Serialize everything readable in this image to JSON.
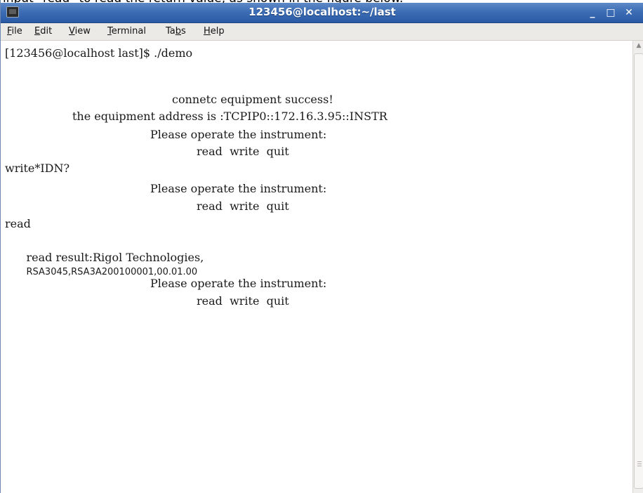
{
  "caption": "input \"read\" to read the return value, as shown in the figure below.",
  "window": {
    "title": "123456@localhost:~/last",
    "controls": {
      "minimize": "_",
      "maximize": "□",
      "close": "✕"
    }
  },
  "menu": [
    {
      "mnemonic": "F",
      "rest": "ile"
    },
    {
      "mnemonic": "E",
      "rest": "dit"
    },
    {
      "mnemonic": "V",
      "rest": "iew"
    },
    {
      "mnemonic": "T",
      "rest": "erminal"
    },
    {
      "pre": "Ta",
      "mnemonic": "b",
      "rest": "s"
    },
    {
      "mnemonic": "H",
      "rest": "elp"
    }
  ],
  "terminal": {
    "prompt": "[123456@localhost last]$ ./demo",
    "connect": "connetc equipment success!",
    "address": "the equipment address is :TCPIP0::172.16.3.95::INSTR",
    "operate1": "Please operate the instrument:",
    "options1": "read  write  quit",
    "cmd1": "write*IDN?",
    "operate2": "Please operate the instrument:",
    "options2": "read  write  quit",
    "cmd2": "read",
    "result_prefix": "read result:Rigol Technologies,",
    "result_value": "RSA3045,RSA3A200100001,00.01.00",
    "operate3": "Please operate the instrument:",
    "options3": "read  write  quit"
  }
}
